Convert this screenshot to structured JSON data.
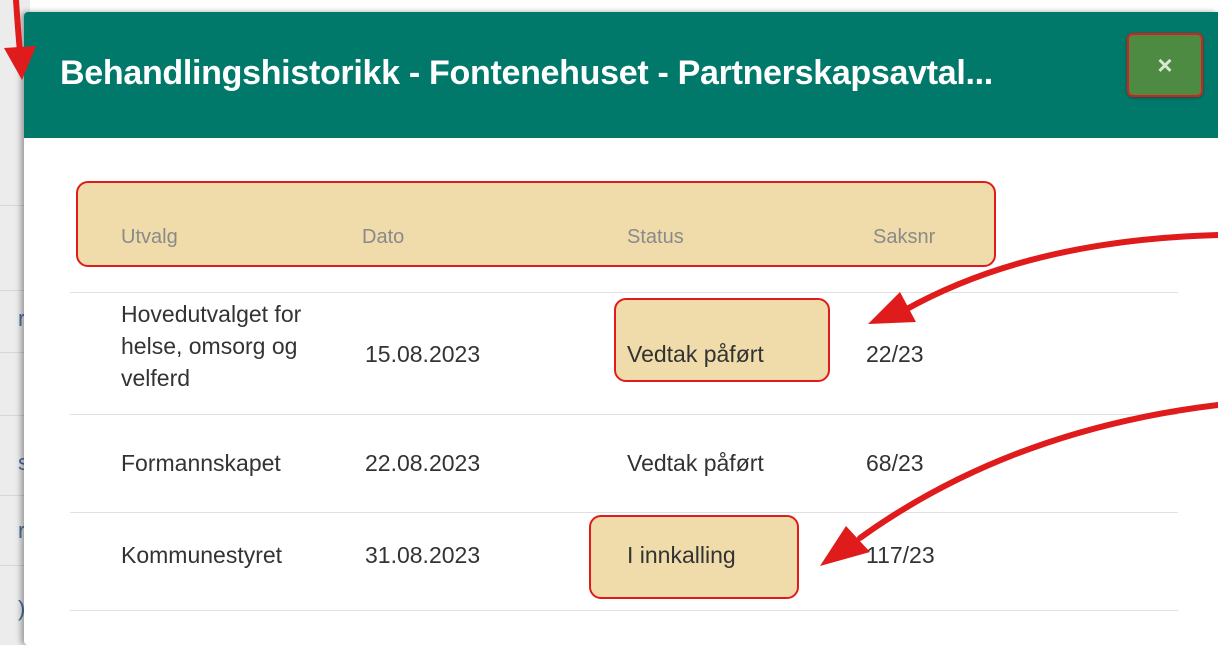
{
  "dialog": {
    "title": "Behandlingshistorikk - Fontenehuset - Partnerskapsavtal...",
    "close_label": "×"
  },
  "table": {
    "headers": [
      "Utvalg",
      "Dato",
      "Status",
      "Saksnr"
    ],
    "rows": [
      {
        "utvalg_lines": [
          "Hovedutvalget for",
          "helse, omsorg og",
          "velferd"
        ],
        "dato": "15.08.2023",
        "status": "Vedtak påført",
        "saksnr": "22/23"
      },
      {
        "utvalg": "Formannskapet",
        "dato": "22.08.2023",
        "status": "Vedtak påført",
        "saksnr": "68/23"
      },
      {
        "utvalg": "Kommunestyret",
        "dato": "31.08.2023",
        "status": "I innkalling",
        "saksnr": "117/23"
      }
    ]
  },
  "background_fragments": [
    "rs",
    "s",
    "r",
    ")"
  ],
  "colors": {
    "header_bg": "#00796b",
    "close_bg": "#4d8a42",
    "highlight_fill": "#f0dcab",
    "annotation_red": "#e01b1b"
  }
}
